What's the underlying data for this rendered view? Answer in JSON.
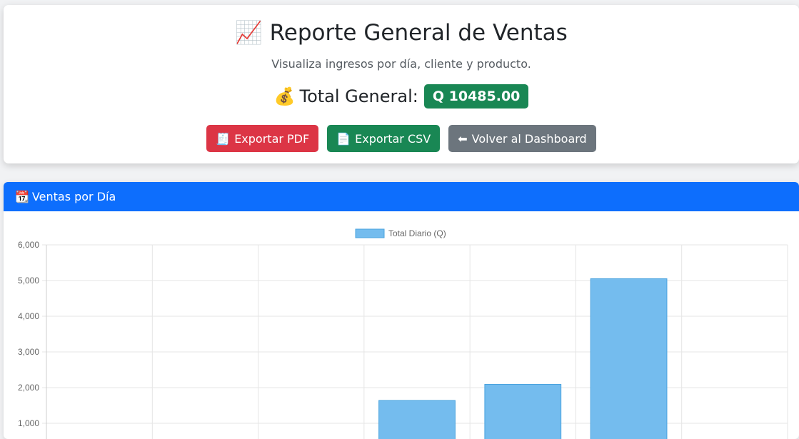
{
  "header": {
    "title_icon": "📈",
    "title": "Reporte General de Ventas",
    "subtitle": "Visualiza ingresos por día, cliente y producto.",
    "total_icon": "💰",
    "total_label": "Total General:",
    "total_value": "Q 10485.00"
  },
  "buttons": [
    {
      "icon": "🧾",
      "label": "Exportar PDF",
      "color": "#dc3545"
    },
    {
      "icon": "📄",
      "label": "Exportar CSV",
      "color": "#198754"
    },
    {
      "icon": "⬅",
      "label": "Volver al Dashboard",
      "color": "#6c757d"
    }
  ],
  "chart_card": {
    "icon": "📆",
    "title": "Ventas por Día"
  },
  "colors": {
    "primary": "#0d6efd",
    "bar_fill": "#74bcee",
    "bar_stroke": "#4aa3df"
  },
  "chart_data": {
    "type": "bar",
    "legend": "Total Diario (Q)",
    "legend_position": "top-center",
    "categories": [
      "",
      "",
      "",
      "",
      "",
      "",
      ""
    ],
    "values": [
      0,
      0,
      0,
      1640,
      2090,
      5050,
      0
    ],
    "ylim": [
      0,
      6000
    ],
    "yticks": [
      "1,000",
      "2,000",
      "3,000",
      "4,000",
      "5,000",
      "6,000"
    ],
    "ytick_values": [
      1000,
      2000,
      3000,
      4000,
      5000,
      6000
    ],
    "grid": true
  }
}
